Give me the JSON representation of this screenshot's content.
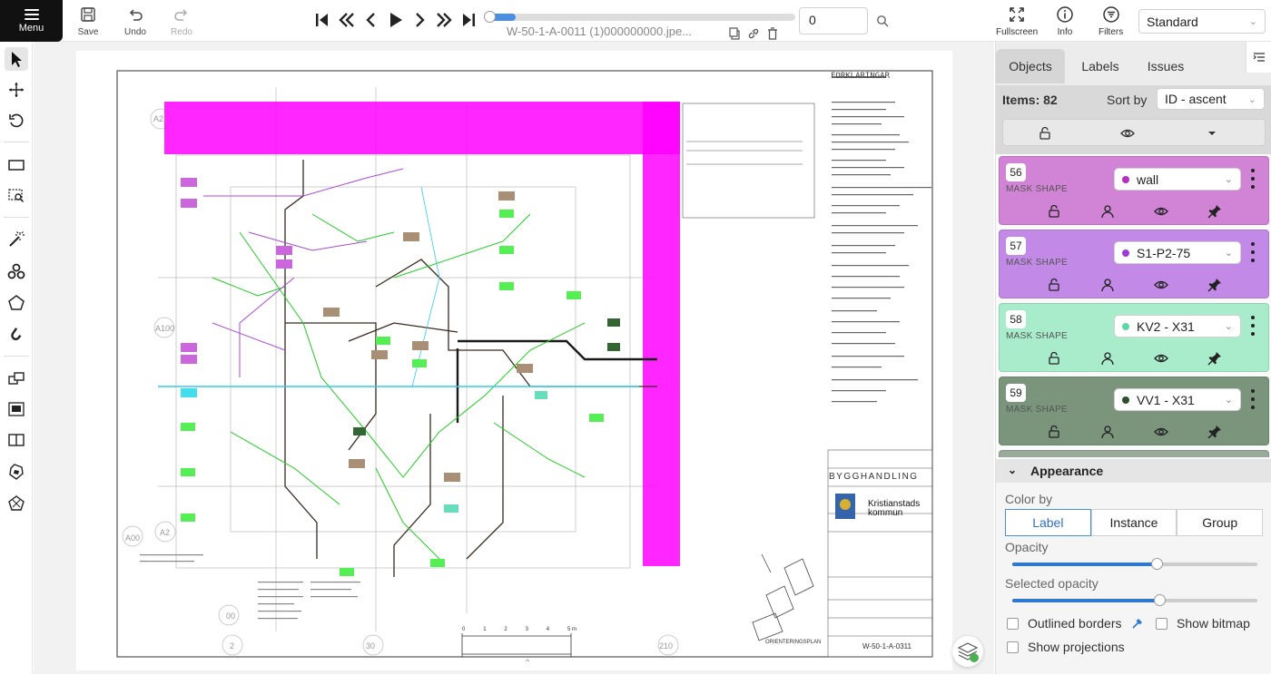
{
  "toolbar": {
    "menu_label": "Menu",
    "save_label": "Save",
    "undo_label": "Undo",
    "redo_label": "Redo",
    "filename": "W-50-1-A-0011 (1)000000000.jpe...",
    "frame_value": "0",
    "fullscreen_label": "Fullscreen",
    "info_label": "Info",
    "filters_label": "Filters",
    "workspace_select": "Standard",
    "player_progress": 0.09
  },
  "sidebar": {
    "tabs": [
      {
        "label": "Objects"
      },
      {
        "label": "Labels"
      },
      {
        "label": "Issues"
      }
    ],
    "items_label": "Items: 82",
    "sort_label": "Sort by",
    "sort_value": "ID - ascent",
    "objects": [
      {
        "id": "56",
        "type": "MASK SHAPE",
        "label": "wall",
        "color": "#d184d6",
        "dot": "#b32fc0"
      },
      {
        "id": "57",
        "type": "MASK SHAPE",
        "label": "S1-P2-75",
        "color": "#c28ae6",
        "dot": "#9c3bd8"
      },
      {
        "id": "58",
        "type": "MASK SHAPE",
        "label": "KV2 - X31",
        "color": "#a8eccb",
        "dot": "#5fd8a6"
      },
      {
        "id": "59",
        "type": "MASK SHAPE",
        "label": "VV1 - X31",
        "color": "#7a957c",
        "dot": "#2f4d31"
      }
    ],
    "appearance": {
      "title": "Appearance",
      "color_by_label": "Color by",
      "color_by_options": [
        "Label",
        "Instance",
        "Group"
      ],
      "color_by_selected": "Label",
      "opacity_label": "Opacity",
      "opacity_value": 0.59,
      "selected_opacity_label": "Selected opacity",
      "selected_opacity_value": 0.6,
      "outlined_borders_label": "Outlined borders",
      "show_bitmap_label": "Show bitmap",
      "show_projections_label": "Show projections"
    }
  },
  "drawing": {
    "sheet_number": "W-50-1-A-0311",
    "title": "BYGGHANDLING",
    "client": "Kristianstads kommun",
    "status": "BYGGHANDLING",
    "legend_title": "FÖRKLARINGAR",
    "orientation_label": "ORIENTERINGSPLAN",
    "scale_labels": [
      "0",
      "1",
      "2",
      "3",
      "4",
      "5 m"
    ],
    "grid_refs": [
      "A2",
      "A100",
      "A00",
      "A2",
      "00",
      "2",
      "30",
      "210"
    ]
  },
  "colors": {
    "accent": "#4a90e2",
    "wall": "#ff00ff",
    "cyan_line": "#33ccee",
    "green_line": "#22cc22"
  }
}
